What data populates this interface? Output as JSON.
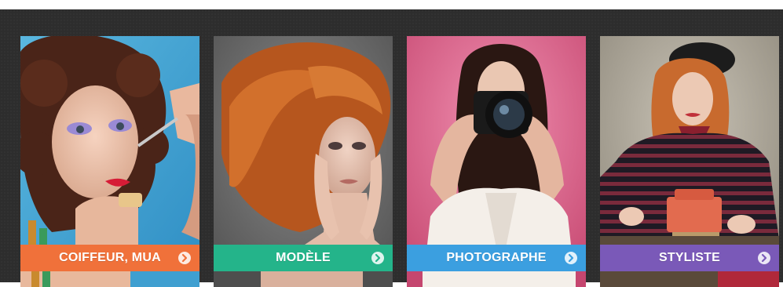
{
  "cards": [
    {
      "label": "COIFFEUR, MUA",
      "accent": "#f0713a",
      "background": "#46a9d6"
    },
    {
      "label": "MODÈLE",
      "accent": "#24b48a",
      "background": "#777777"
    },
    {
      "label": "PHOTOGRAPHE",
      "accent": "#3b9fe0",
      "background": "#d95f88"
    },
    {
      "label": "STYLISTE",
      "accent": "#7a59b8",
      "background": "#a9a397"
    }
  ],
  "icons": {
    "arrow": "arrow-right-circle-icon"
  }
}
